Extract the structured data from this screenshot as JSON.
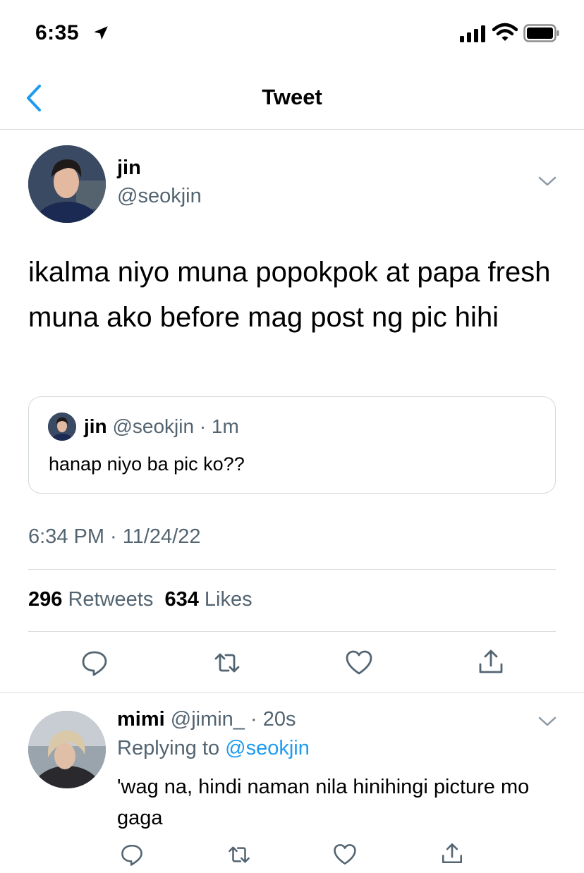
{
  "status_bar": {
    "time": "6:35"
  },
  "nav": {
    "title": "Tweet"
  },
  "tweet": {
    "author_name": "jin",
    "author_handle": "@seokjin",
    "text": "ikalma niyo muna popokpok at papa fresh muna ako before mag post ng pic hihi",
    "quote": {
      "name": "jin",
      "meta": "@seokjin · 1m",
      "text": "hanap niyo ba pic ko??"
    },
    "timestamp": "6:34 PM · 11/24/22",
    "retweets_count": "296",
    "retweets_label": "Retweets",
    "likes_count": "634",
    "likes_label": "Likes"
  },
  "reply": {
    "name": "mimi",
    "meta": "@jimin_ · 20s",
    "replying_prefix": "Replying to",
    "replying_to": "@seokjin",
    "text": "'wag na, hindi naman nila hinihingi picture mo gaga"
  },
  "icons": [
    "location-arrow-icon",
    "signal-icon",
    "wifi-icon",
    "battery-icon",
    "back-icon",
    "chevron-down-icon",
    "reply-icon",
    "retweet-icon",
    "like-icon",
    "share-icon"
  ],
  "colors": {
    "accent": "#1d9bf0",
    "secondary_text": "#536471",
    "divider": "#d9dde0"
  }
}
